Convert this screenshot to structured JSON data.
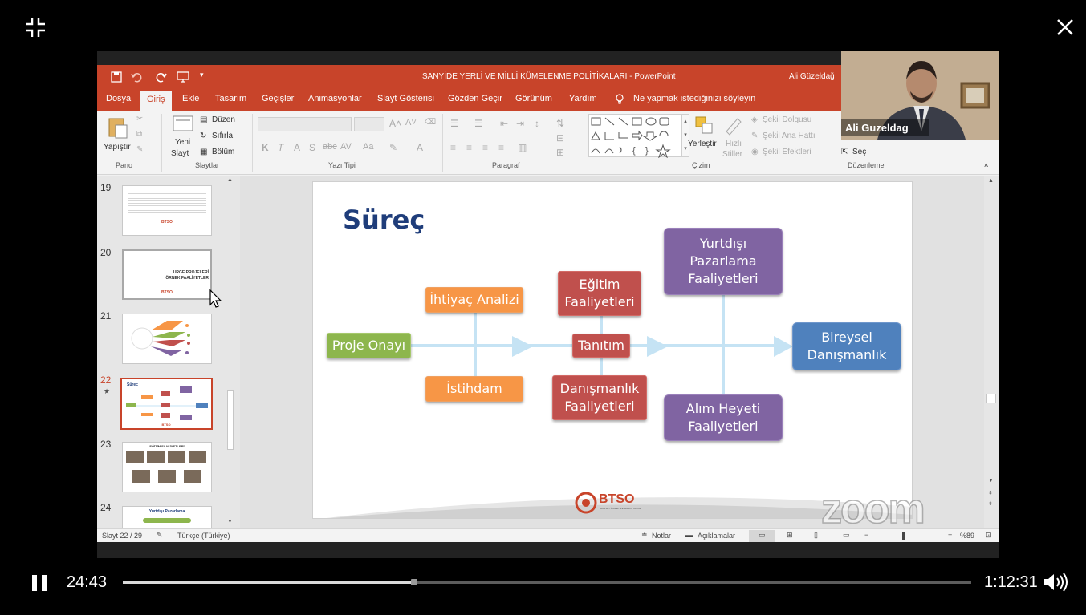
{
  "player": {
    "current_time": "24:43",
    "total_time": "1:12:31",
    "progress": 0.3417
  },
  "ppt": {
    "window_title": "SANYİDE YERLİ VE MİLLİ KÜMELENME POLİTİKALARI  -  PowerPoint",
    "user": "Ali Güzeldağ",
    "tabs": [
      "Dosya",
      "Giriş",
      "Ekle",
      "Tasarım",
      "Geçişler",
      "Animasyonlar",
      "Slayt Gösterisi",
      "Gözden Geçir",
      "Görünüm",
      "Yardım"
    ],
    "tell_me": "Ne yapmak istediğinizi söyleyin",
    "ribbon": {
      "paste": "Yapıştır",
      "new_slide_1": "Yeni",
      "new_slide_2": "Slayt",
      "layout": "Düzen",
      "reset": "Sıfırla",
      "section": "Bölüm",
      "arrange": "Yerleştir",
      "quick_styles_1": "Hızlı",
      "quick_styles_2": "Stiller",
      "shape_fill": "Şekil Dolgusu",
      "shape_outline": "Şekil Ana Hattı",
      "shape_effects": "Şekil Efektleri",
      "select": "Seç",
      "groups": {
        "clipboard": "Pano",
        "slides": "Slaytlar",
        "font": "Yazı Tipi",
        "paragraph": "Paragraf",
        "drawing": "Çizim",
        "editing": "Düzenleme"
      }
    },
    "thumbnails": [
      {
        "num": "19",
        "title": ""
      },
      {
        "num": "20",
        "title": "URGE PROJELERİ ÖRNEK FAALİYETLER"
      },
      {
        "num": "21",
        "title": ""
      },
      {
        "num": "22",
        "title": "Süreç"
      },
      {
        "num": "23",
        "title": "EĞİTİM FAALİYETLERİ"
      },
      {
        "num": "24",
        "title": "Yurtdışı Pazarlama"
      }
    ],
    "slide": {
      "title": "Süreç",
      "logo": "BTSO",
      "logo_sub": "BURSA TİCARET VE SANAYİ ODASI",
      "boxes": {
        "proje_onayi": "Proje Onayı",
        "ihtiyac": "İhtiyaç Analizi",
        "istihdam": "İstihdam",
        "egitim": "Eğitim Faaliyetleri",
        "tanitim": "Tanıtım",
        "danismanlik": "Danışmanlık Faaliyetleri",
        "yurtdisi": "Yurtdışı Pazarlama Faaliyetleri",
        "alim": "Alım Heyeti Faaliyetleri",
        "bireysel": "Bireysel Danışmanlık"
      }
    },
    "status": {
      "slide_info": "Slayt 22 / 29",
      "language": "Türkçe (Türkiye)",
      "notes": "Notlar",
      "comments": "Açıklamalar",
      "zoom": "%89"
    }
  },
  "camera": {
    "name": "Ali Guzeldag"
  },
  "watermark": "zoom"
}
